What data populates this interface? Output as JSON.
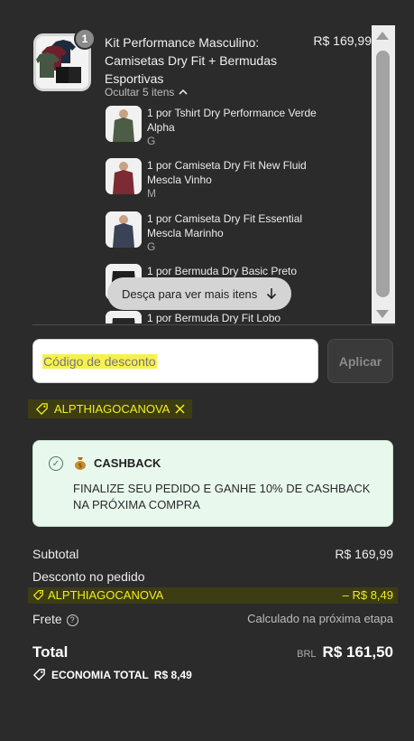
{
  "order": {
    "main_item": {
      "quantity": "1",
      "title": "Kit Performance Masculino: Camisetas Dry Fit + Bermudas Esportivas",
      "price": "R$ 169,99",
      "toggle_label": "Ocultar 5 itens"
    },
    "sub_items": [
      {
        "name": "1 por Tshirt Dry Performance Verde Alpha",
        "variant": "G",
        "color": "#4d5c44"
      },
      {
        "name": "1 por Camiseta Dry Fit New Fluid Mescla Vinho",
        "variant": "M",
        "color": "#7c2a34"
      },
      {
        "name": "1 por Camiseta Dry Fit Essential Mescla Marinho",
        "variant": "G",
        "color": "#3a4356"
      },
      {
        "name": "1 por Bermuda Dry Basic Preto",
        "variant": "",
        "color": "#1e1e1e"
      },
      {
        "name": "1 por Bermuda Dry Fit Lobo",
        "variant": "",
        "color": "#262626"
      }
    ],
    "scroll_hint": "Desça para ver mais itens"
  },
  "discount": {
    "placeholder": "Código de desconto",
    "apply_label": "Aplicar",
    "applied_code": "ALPTHIAGOCANOVA"
  },
  "cashback": {
    "title": "CASHBACK",
    "text": "FINALIZE SEU PEDIDO E GANHE 10% DE CASHBACK NA PRÓXIMA COMPRA"
  },
  "summary": {
    "subtotal_label": "Subtotal",
    "subtotal_value": "R$ 169,99",
    "discount_label": "Desconto no pedido",
    "discount_code": "ALPTHIAGOCANOVA",
    "discount_value": "– R$ 8,49",
    "shipping_label": "Frete",
    "shipping_value": "Calculado na próxima etapa",
    "total_label": "Total",
    "currency": "BRL",
    "total_value": "R$ 161,50",
    "economy_label": "ECONOMIA TOTAL",
    "economy_value": "R$ 8,49"
  },
  "colors": {
    "background": "#2b2b2b",
    "highlight": "#f2ec20",
    "cashback_bg": "#e9f8ec"
  }
}
